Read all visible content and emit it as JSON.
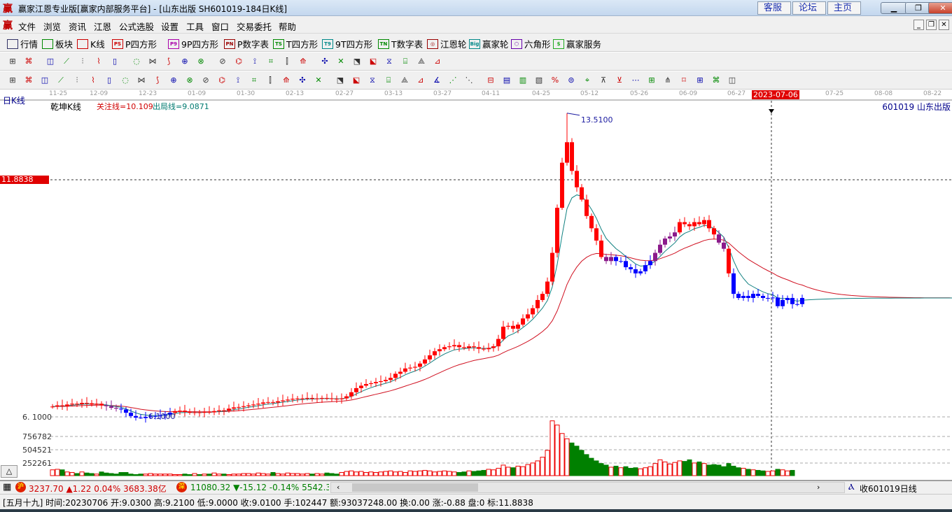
{
  "window": {
    "title": "赢家江恩专业版[赢家内部服务平台] - [山东出版  SH601019-184日K线]",
    "links": [
      "客服",
      "论坛",
      "主页"
    ],
    "logo": "赢"
  },
  "menu": [
    "文件",
    "浏览",
    "资讯",
    "江恩",
    "公式选股",
    "设置",
    "工具",
    "窗口",
    "交易委托",
    "帮助"
  ],
  "toolbar": [
    {
      "label": "行情",
      "icon": "grid-icon",
      "tag": ""
    },
    {
      "label": "板块",
      "icon": "blocks-icon",
      "tag": ""
    },
    {
      "label": "K线",
      "icon": "candles-icon",
      "tag": ""
    },
    {
      "label": "P四方形",
      "icon": "ps-icon",
      "tag": "PS"
    },
    {
      "label": "9P四方形",
      "icon": "p9-icon",
      "tag": "P9"
    },
    {
      "label": "P数字表",
      "icon": "pn-icon",
      "tag": "PN"
    },
    {
      "label": "T四方形",
      "icon": "ts-icon",
      "tag": "TS"
    },
    {
      "label": "9T四方形",
      "icon": "t9-icon",
      "tag": "T9"
    },
    {
      "label": "T数字表",
      "icon": "tn-icon",
      "tag": "TN"
    },
    {
      "label": "江恩轮",
      "icon": "gann-wheel-icon",
      "tag": "◎"
    },
    {
      "label": "赢家轮",
      "icon": "big-wheel-icon",
      "tag": "Big"
    },
    {
      "label": "六角形",
      "icon": "hexagon-icon",
      "tag": "⬡"
    },
    {
      "label": "赢家服务",
      "icon": "dollar-icon",
      "tag": "$"
    }
  ],
  "chart": {
    "period_label": "日K线",
    "indicator_name": "乾坤K线",
    "focus_line": "关注线=10.109",
    "exit_line": "出局线=9.0871",
    "stock": "601019  山东出版",
    "cursor_date": "2023-07-06",
    "cursor_price": "11.8838",
    "high_label": "13.5100",
    "low_label": "6.1000",
    "axis_low": "6. 1000",
    "volume_ticks": [
      "756782",
      "504521",
      "252261"
    ],
    "dates": [
      "11-25",
      "12-09",
      "12-23",
      "01-09",
      "01-30",
      "02-13",
      "02-27",
      "03-13",
      "03-27",
      "04-11",
      "04-25",
      "05-12",
      "05-26",
      "06-09",
      "06-27",
      "07-25",
      "08-08",
      "08-22"
    ]
  },
  "chart_data": {
    "type": "candlestick",
    "title": "乾坤K线",
    "ylim": [
      6.1,
      13.51
    ],
    "peak": 13.51,
    "trough": 6.05,
    "close": [
      6.35,
      6.38,
      6.36,
      6.4,
      6.42,
      6.41,
      6.44,
      6.43,
      6.4,
      6.42,
      6.38,
      6.36,
      6.32,
      6.3,
      6.28,
      6.2,
      6.12,
      6.08,
      6.07,
      6.1,
      6.11,
      6.12,
      6.14,
      6.16,
      6.2,
      6.24,
      6.25,
      6.22,
      6.2,
      6.21,
      6.2,
      6.22,
      6.21,
      6.24,
      6.26,
      6.25,
      6.3,
      6.33,
      6.34,
      6.36,
      6.38,
      6.4,
      6.42,
      6.45,
      6.46,
      6.45,
      6.48,
      6.5,
      6.52,
      6.54,
      6.55,
      6.55,
      6.56,
      6.54,
      6.55,
      6.56,
      6.55,
      6.54,
      6.53,
      6.55,
      6.6,
      6.7,
      6.8,
      6.86,
      6.9,
      6.92,
      6.95,
      6.97,
      7.0,
      7.05,
      7.15,
      7.2,
      7.28,
      7.3,
      7.32,
      7.4,
      7.5,
      7.6,
      7.7,
      7.75,
      7.8,
      7.82,
      7.85,
      7.8,
      7.78,
      7.82,
      7.8,
      7.76,
      7.75,
      7.78,
      7.82,
      8.0,
      8.3,
      8.32,
      8.25,
      8.35,
      8.5,
      8.6,
      8.75,
      8.95,
      9.1,
      9.4,
      10.1,
      11.2,
      12.3,
      12.8,
      12.1,
      11.7,
      11.4,
      11.0,
      10.7,
      10.4,
      10.0,
      9.9,
      10.0,
      9.9,
      9.9,
      9.75,
      9.7,
      9.6,
      9.65,
      9.8,
      9.9,
      10.1,
      10.3,
      10.45,
      10.5,
      10.6,
      10.85,
      10.8,
      10.75,
      10.85,
      10.8,
      10.9,
      10.7,
      10.55,
      10.35,
      10.2,
      9.6,
      9.1,
      9.0,
      9.05,
      9.0,
      9.1,
      9.05,
      9.0,
      9.0,
      9.01,
      8.8,
      8.95,
      9.0,
      8.85,
      8.85,
      9.0
    ],
    "volume": [
      110000,
      120000,
      110000,
      70000,
      60000,
      40000,
      70000,
      50000,
      40000,
      30000,
      70000,
      50000,
      40000,
      30000,
      60000,
      60000,
      30000,
      20000,
      30000,
      30000,
      40000,
      30000,
      30000,
      30000,
      30000,
      20000,
      20000,
      30000,
      20000,
      40000,
      20000,
      30000,
      30000,
      50000,
      30000,
      30000,
      20000,
      30000,
      30000,
      40000,
      40000,
      30000,
      50000,
      40000,
      30000,
      60000,
      40000,
      30000,
      50000,
      40000,
      40000,
      30000,
      40000,
      30000,
      40000,
      30000,
      50000,
      40000,
      30000,
      60000,
      80000,
      90000,
      70000,
      80000,
      60000,
      70000,
      60000,
      70000,
      80000,
      90000,
      70000,
      80000,
      60000,
      90000,
      80000,
      90000,
      100000,
      90000,
      70000,
      80000,
      90000,
      80000,
      70000,
      60000,
      70000,
      90000,
      80000,
      90000,
      100000,
      120000,
      110000,
      140000,
      200000,
      160000,
      150000,
      180000,
      170000,
      210000,
      240000,
      280000,
      350000,
      480000,
      1040000,
      960000,
      800000,
      700000,
      620000,
      560000,
      480000,
      400000,
      330000,
      280000,
      230000,
      200000,
      160000,
      180000,
      150000,
      170000,
      140000,
      150000,
      130000,
      150000,
      170000,
      230000,
      300000,
      260000,
      220000,
      250000,
      280000,
      270000,
      300000,
      240000,
      260000,
      230000,
      200000,
      210000,
      200000,
      170000,
      230000,
      180000,
      150000,
      140000,
      120000,
      110000,
      100000,
      90000,
      80000,
      90000,
      120000,
      110000,
      90000,
      100000
    ],
    "state": "rrrrrrrrrrrpppbbbbbbbbbbbrrrrrrrrrrrrrrrrrrrrrrrrrrrrrrrrrrrrrrrrrrrrrrrrrrrrrrrrrrrrrrrrrrrrrrrrrrrrrrrrrrrrrrrrppbbbbbbbbppppprrrrrrrrpprbbbbbbbbbbbbbbbb"
  },
  "status_bar": {
    "sh_badge": "沪",
    "sh": "3237.70 ▲1.22 0.04% 3683.38亿",
    "sz_badge": "深",
    "sz": "11080.32 ▼-15.12 -0.14% 5542.38",
    "right": "收601019日线",
    "info": "[五月十九] 时间:20230706 开:9.0300 高:9.2100 低:9.0000 收:9.0100 手:102447 额:93037248.00 换:0.00 涨:-0.88 盘:0 标:11.8838"
  }
}
